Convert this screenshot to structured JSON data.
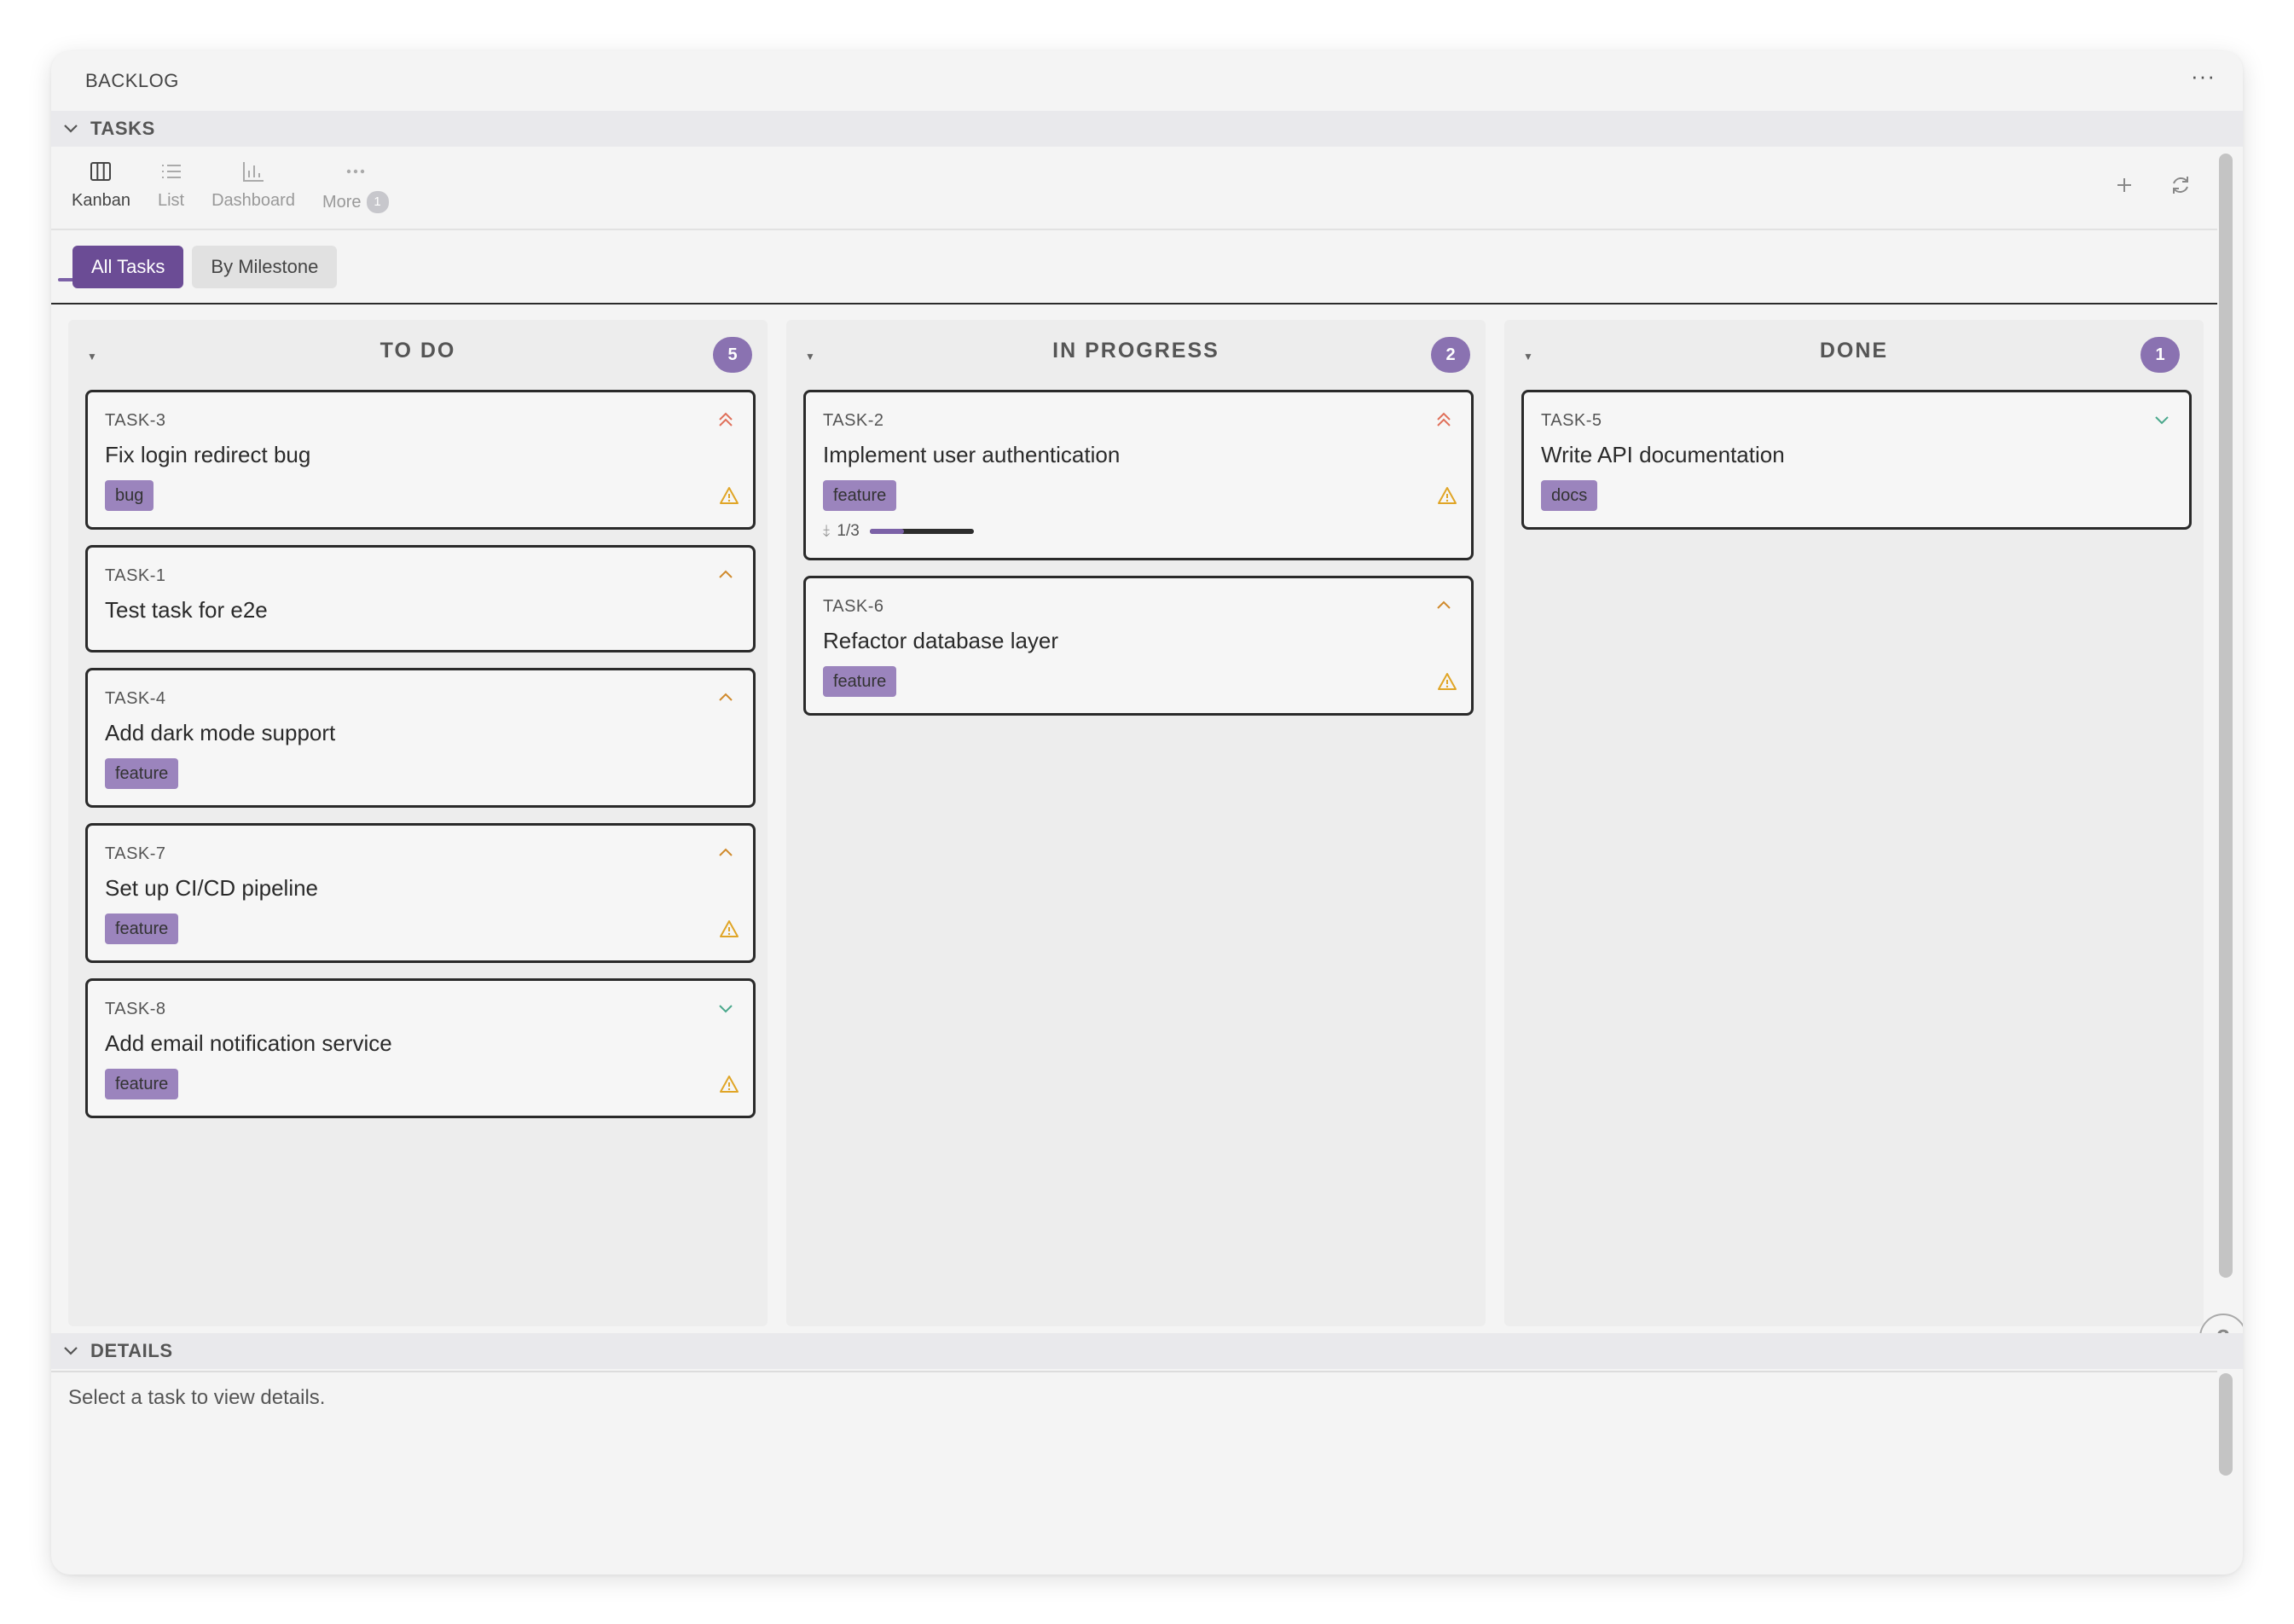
{
  "window": {
    "title": "BACKLOG",
    "menu_icon": "ellipsis-icon"
  },
  "tasks_section": {
    "label": "TASKS"
  },
  "view_tabs": [
    {
      "label": "Kanban",
      "icon": "columns-icon",
      "active": true
    },
    {
      "label": "List",
      "icon": "list-icon",
      "active": false
    },
    {
      "label": "Dashboard",
      "icon": "bar-chart-icon",
      "active": false
    },
    {
      "label": "More",
      "icon": "ellipsis-icon",
      "badge": "1",
      "active": false
    }
  ],
  "toolbar": {
    "add_icon": "plus-icon",
    "refresh_icon": "refresh-icon"
  },
  "filters": [
    {
      "label": "All Tasks",
      "active": true
    },
    {
      "label": "By Milestone",
      "active": false
    }
  ],
  "columns": [
    {
      "name": "TO DO",
      "count": "5",
      "cards": [
        {
          "id": "TASK-3",
          "title": "Fix login redirect bug",
          "priority": "high",
          "tag": "bug",
          "warning": true
        },
        {
          "id": "TASK-1",
          "title": "Test task for e2e",
          "priority": "medium",
          "tag": "",
          "warning": false
        },
        {
          "id": "TASK-4",
          "title": "Add dark mode support",
          "priority": "medium",
          "tag": "feature",
          "warning": false
        },
        {
          "id": "TASK-7",
          "title": "Set up CI/CD pipeline",
          "priority": "medium",
          "tag": "feature",
          "warning": true
        },
        {
          "id": "TASK-8",
          "title": "Add email notification service",
          "priority": "low",
          "tag": "feature",
          "warning": true
        }
      ]
    },
    {
      "name": "IN PROGRESS",
      "count": "2",
      "cards": [
        {
          "id": "TASK-2",
          "title": "Implement user authentication",
          "priority": "high",
          "tag": "feature",
          "warning": true,
          "subtasks": "1/3",
          "progress": 0.33
        },
        {
          "id": "TASK-6",
          "title": "Refactor database layer",
          "priority": "medium",
          "tag": "feature",
          "warning": true
        }
      ]
    },
    {
      "name": "DONE",
      "count": "1",
      "cards": [
        {
          "id": "TASK-5",
          "title": "Write API documentation",
          "priority": "low",
          "tag": "docs",
          "warning": false
        }
      ]
    }
  ],
  "help_button": {
    "label": "?"
  },
  "details_section": {
    "label": "DETAILS",
    "empty_text": "Select a task to view details."
  },
  "colors": {
    "accent": "#6b4c95",
    "tag": "#9b84bd",
    "priority_high": "#e0705a",
    "priority_medium": "#d08a2c",
    "priority_low": "#4aa88c",
    "warning": "#e0a526"
  }
}
